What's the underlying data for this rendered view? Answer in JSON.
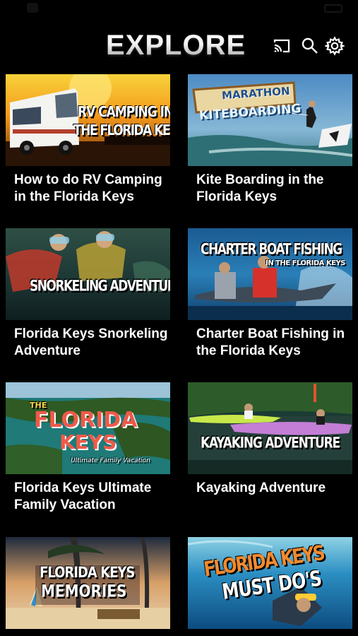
{
  "header": {
    "title": "EXPLORE"
  },
  "icons": {
    "cast": "cast-icon",
    "search": "search-icon",
    "settings": "gear-icon"
  },
  "videos": [
    {
      "caption": "How to do RV Camping in the Florida Keys",
      "overlay1": "RV CAMPING IN",
      "overlay2": "THE FLORIDA KEYS"
    },
    {
      "caption": "Kite Boarding in the Florida Keys",
      "overlay1": "MARATHON",
      "overlay2": "KITEBOARDING"
    },
    {
      "caption": "Florida Keys Snorkeling Adventure",
      "overlay1": "SNORKELING ADVENTURE"
    },
    {
      "caption": "Charter Boat Fishing in the Florida Keys",
      "overlay1": "CHARTER BOAT FISHING",
      "overlay2": "IN THE FLORIDA KEYS"
    },
    {
      "caption": "Florida Keys Ultimate Family Vacation",
      "overlay1": "THE",
      "overlay2": "FLORIDA",
      "overlay3": "KEYS",
      "overlay4": "Ultimate Family Vacation"
    },
    {
      "caption": "Kayaking Adventure",
      "overlay1": "KAYAKING ADVENTURE"
    },
    {
      "caption": "",
      "overlay1": "FLORIDA KEYS",
      "overlay2": "MEMORIES"
    },
    {
      "caption": "",
      "overlay1": "FLORIDA KEYS",
      "overlay2": "MUST DO'S"
    }
  ]
}
